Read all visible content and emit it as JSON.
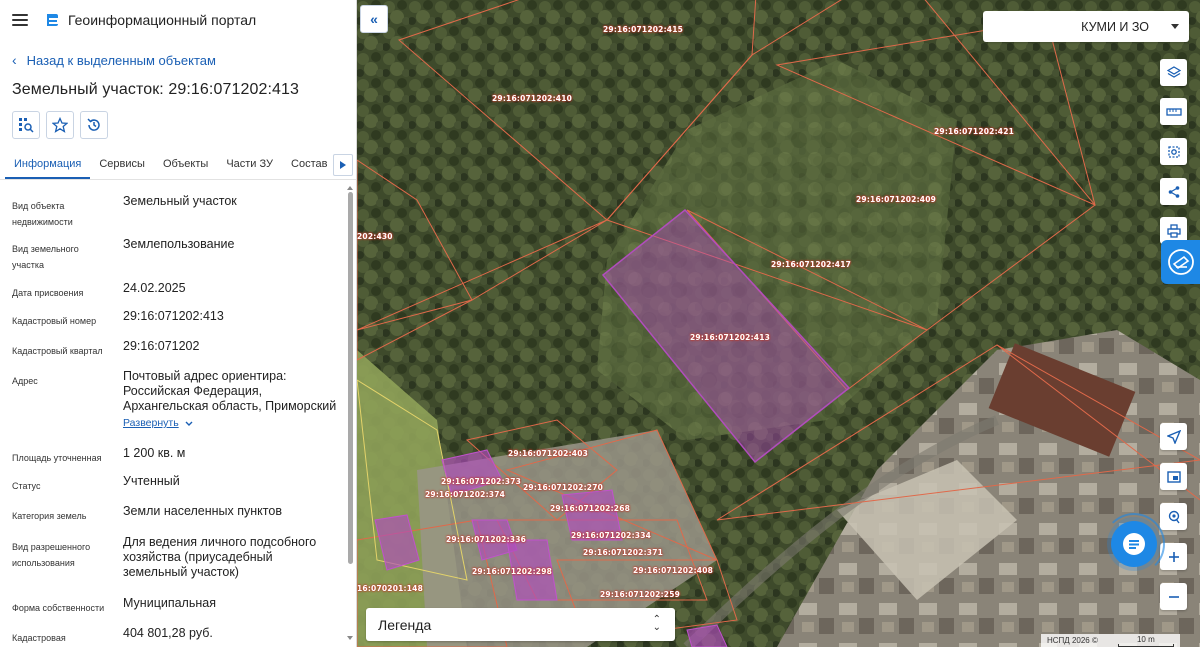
{
  "app": {
    "title": "Геоинформационный портал"
  },
  "nav": {
    "back_label": "Назад к выделенным объектам"
  },
  "object": {
    "title": "Земельный участок: 29:16:071202:413"
  },
  "tabs": [
    {
      "label": "Информация"
    },
    {
      "label": "Сервисы"
    },
    {
      "label": "Объекты"
    },
    {
      "label": "Части ЗУ"
    },
    {
      "label": "Состав"
    }
  ],
  "attributes": [
    {
      "key": "Вид объекта недвижимости",
      "value": "Земельный участок"
    },
    {
      "key": "Вид земельного участка",
      "value": "Землепользование"
    },
    {
      "key": "Дата присвоения",
      "value": "24.02.2025"
    },
    {
      "key": "Кадастровый номер",
      "value": "29:16:071202:413"
    },
    {
      "key": "Кадастровый квартал",
      "value": "29:16:071202"
    },
    {
      "key": "Адрес",
      "value": "Почтовый адрес ориентира: Российская Федерация, Архангельская область, Приморский",
      "expand_label": "Развернуть"
    },
    {
      "key": "Площадь уточненная",
      "value": "1 200 кв. м"
    },
    {
      "key": "Статус",
      "value": "Учтенный"
    },
    {
      "key": "Категория земель",
      "value": "Земли населенных пунктов"
    },
    {
      "key": "Вид разрешенного использования",
      "value": "Для ведения личного подсобного хозяйства (приусадебный земельный участок)"
    },
    {
      "key": "Форма собственности",
      "value": "Муниципальная"
    },
    {
      "key": "Кадастровая",
      "value": "404 801,28 руб."
    }
  ],
  "map": {
    "layer_select": "КУМИ И ЗО",
    "legend_label": "Легенда",
    "attribution": "НСПД 2026 ©",
    "scale_label": "10 m",
    "parcel_labels": [
      "29:16:071202:415",
      "29:16:071202:410",
      "29:16:071202:421",
      "29:16:071202:409",
      "29:16:071202:417",
      "29:16:071202:413",
      "202:430",
      "29:16:071202:403",
      "29:16:071202:373",
      "29:16:071202:374",
      "29:16:071202:270",
      "29:16:071202:268",
      "29:16:071202:336",
      "29:16:071202:334",
      "29:16:071202:371",
      "29:16:071202:408",
      "29:16:071202:298",
      "29:16:071202:259",
      "16:070201:148"
    ],
    "tools": [
      "layers-icon",
      "ruler-icon",
      "select-area-icon",
      "share-icon",
      "print-icon",
      "pkk-icon",
      "locate-icon",
      "minimap-icon",
      "geolocation-icon",
      "zoom-in-icon",
      "zoom-out-icon"
    ]
  },
  "colors": {
    "accent": "#1a5fb4",
    "selected_parcel": "#b14dbd",
    "parcel_border": "#e0694a"
  }
}
